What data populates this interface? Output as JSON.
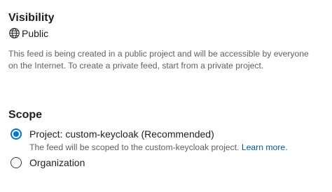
{
  "visibility": {
    "title": "Visibility",
    "icon": "globe-icon",
    "value": "Public",
    "description": "This feed is being created in a public project and will be accessible by everyone on the Internet. To create a private feed, start from a private project."
  },
  "scope": {
    "title": "Scope",
    "options": [
      {
        "label": "Project: custom-keycloak (Recommended)",
        "checked": true,
        "description": "The feed will be scoped to the custom-keycloak project.",
        "link_label": "Learn more."
      },
      {
        "label": "Organization",
        "checked": false
      }
    ]
  },
  "colors": {
    "accent": "#0078d4",
    "link": "#005a9e",
    "secondary_text": "#5f5f5f"
  }
}
